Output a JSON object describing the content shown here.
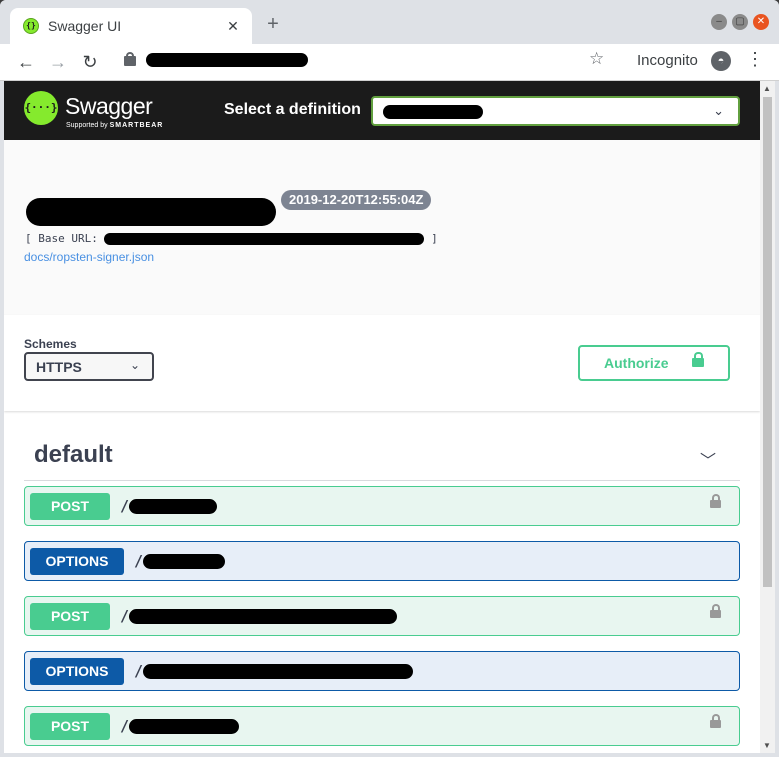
{
  "browser": {
    "tab_title": "Swagger UI",
    "tab_close": "✕",
    "new_tab": "+",
    "back": "←",
    "forward": "→",
    "reload": "↻",
    "star": "☆",
    "incognito_label": "Incognito",
    "menu": "⋮",
    "window_controls": [
      "–",
      "▢",
      "✕"
    ]
  },
  "topbar": {
    "brand": "Swagger",
    "sub_prefix": "Supported by",
    "sub_brand": "SMARTBEAR",
    "logo_glyph": "{···}",
    "definition_label": "Select a definition",
    "definition_chevron": "⌄"
  },
  "info": {
    "version": "2019-12-20T12:55:04Z",
    "base_url_prefix": "[ Base URL: ",
    "base_url_suffix": " ]",
    "spec_link": "docs/ropsten-signer.json"
  },
  "schemes": {
    "label": "Schemes",
    "selected": "HTTPS",
    "authorize_label": "Authorize"
  },
  "tag": {
    "name": "default"
  },
  "operations": [
    {
      "method": "POST",
      "path_prefix": "/",
      "locked": true
    },
    {
      "method": "OPTIONS",
      "path_prefix": "/",
      "locked": false
    },
    {
      "method": "POST",
      "path_prefix": "/",
      "locked": true
    },
    {
      "method": "OPTIONS",
      "path_prefix": "/",
      "locked": false
    },
    {
      "method": "POST",
      "path_prefix": "/",
      "locked": true
    }
  ],
  "colors": {
    "post": "#49cc90",
    "options": "#0d5aa7",
    "swagger_green": "#85ea2d",
    "topbar_bg": "#1b1b1b"
  }
}
